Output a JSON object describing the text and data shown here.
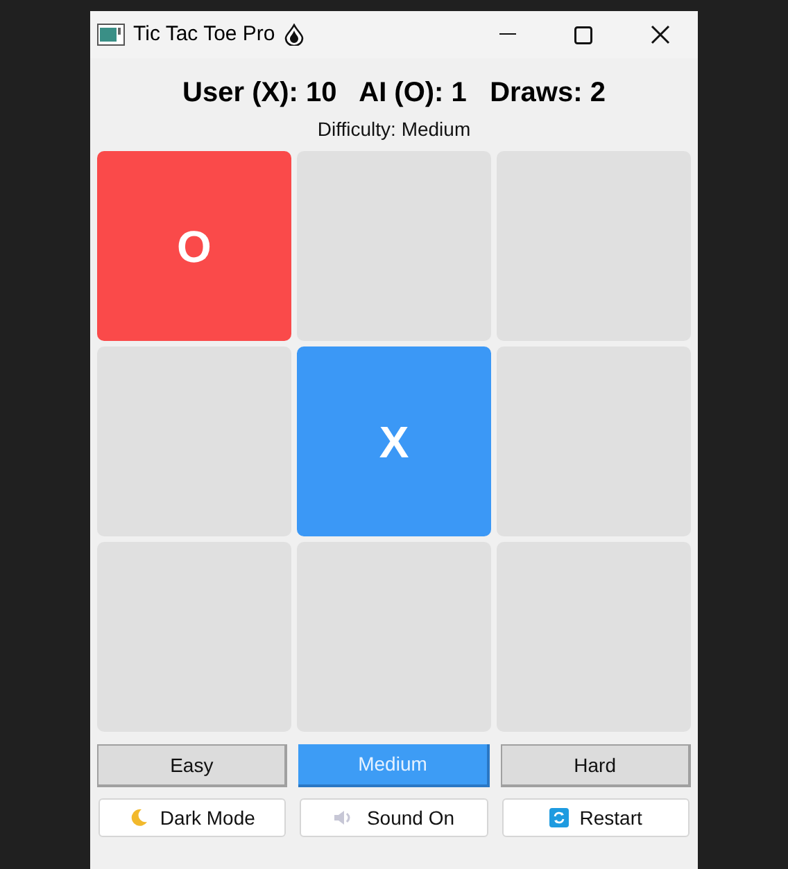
{
  "window": {
    "title": "Tic Tac Toe Pro"
  },
  "score": {
    "text": "User (X): 10   AI (O): 1   Draws: 2"
  },
  "difficulty_label": "Difficulty: Medium",
  "board": [
    {
      "kind": "mark",
      "mark": "O",
      "color": "#fa4a4a"
    },
    {
      "kind": "empty"
    },
    {
      "kind": "empty"
    },
    {
      "kind": "empty"
    },
    {
      "kind": "mark",
      "mark": "X",
      "color": "#3b98f6"
    },
    {
      "kind": "empty"
    },
    {
      "kind": "empty"
    },
    {
      "kind": "empty"
    },
    {
      "kind": "empty"
    }
  ],
  "difficulty_buttons": [
    {
      "label": "Easy",
      "selected": false
    },
    {
      "label": "Medium",
      "selected": true
    },
    {
      "label": "Hard",
      "selected": false
    }
  ],
  "actions": [
    {
      "kind": "moon",
      "label": "Dark Mode"
    },
    {
      "kind": "speaker",
      "label": "Sound On"
    },
    {
      "kind": "restart",
      "label": "Restart"
    }
  ]
}
